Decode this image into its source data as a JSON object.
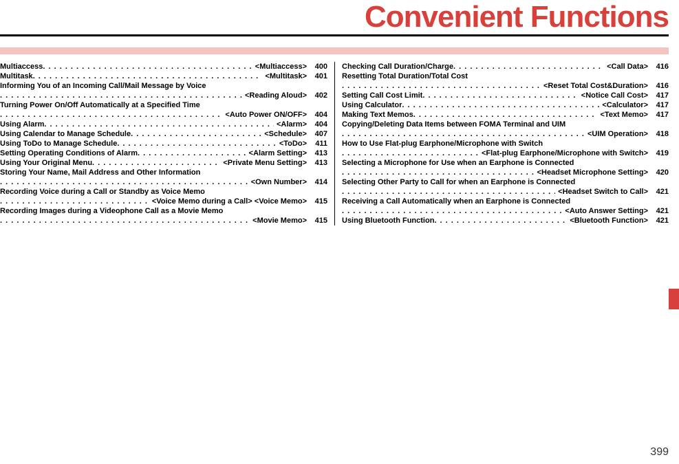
{
  "title": "Convenient Functions",
  "page_number": "399",
  "left": [
    {
      "label": "Multiaccess",
      "tag": "<Multiaccess>",
      "pg": "400"
    },
    {
      "label": "Multitask",
      "tag": "<Multitask>",
      "pg": "401"
    },
    {
      "wrap": "Informing You of an Incoming Call/Mail Message by Voice",
      "tag": "<Reading Aloud>",
      "pg": "402"
    },
    {
      "wrap": "Turning Power On/Off Automatically at a Specified Time",
      "tag": "<Auto Power ON/OFF>",
      "pg": "404"
    },
    {
      "label": "Using Alarm",
      "tag": "<Alarm>",
      "pg": "404"
    },
    {
      "label": "Using Calendar to Manage Schedule",
      "tag": "<Schedule>",
      "pg": "407"
    },
    {
      "label": "Using ToDo to Manage Schedule",
      "tag": "<ToDo>",
      "pg": "411"
    },
    {
      "label": "Setting Operating Conditions of Alarm",
      "tag": "<Alarm Setting>",
      "pg": "413"
    },
    {
      "label": "Using Your Original Menu",
      "tag": "<Private Menu Setting>",
      "pg": "413"
    },
    {
      "wrap": "Storing Your Name, Mail Address and Other Information",
      "tag": "<Own Number>",
      "pg": "414"
    },
    {
      "wrap": "Recording Voice during a Call or Standby as Voice Memo",
      "tag": "<Voice Memo during a Call> <Voice Memo>",
      "pg": "415"
    },
    {
      "wrap": "Recording Images during a Videophone Call as a Movie Memo",
      "tag": "<Movie Memo>",
      "pg": "415"
    }
  ],
  "right": [
    {
      "label": "Checking Call Duration/Charge",
      "tag": "<Call Data>",
      "pg": "416"
    },
    {
      "wrap": "Resetting Total Duration/Total Cost",
      "tag": "<Reset Total Cost&Duration>",
      "pg": "416"
    },
    {
      "label": "Setting Call Cost Limit",
      "tag": "<Notice Call Cost>",
      "pg": "417"
    },
    {
      "label": "Using Calculator",
      "tag": "<Calculator>",
      "pg": "417"
    },
    {
      "label": "Making Text Memos",
      "tag": "<Text Memo>",
      "pg": "417"
    },
    {
      "wrap": "Copying/Deleting Data Items between FOMA Terminal and UIM",
      "tag": "<UIM Operation>",
      "pg": "418"
    },
    {
      "wrap": "How to Use Flat-plug Earphone/Microphone with Switch",
      "tag": "<Flat-plug Earphone/Microphone with Switch>",
      "pg": "419"
    },
    {
      "wrap": "Selecting a Microphone for Use when an Earphone is Connected",
      "tag": "<Headset Microphone Setting>",
      "pg": "420"
    },
    {
      "wrap": "Selecting Other Party to Call for when an Earphone is Connected",
      "tag": "<Headset Switch to Call>",
      "pg": "421"
    },
    {
      "wrap": "Receiving a Call Automatically when an Earphone is Connected",
      "tag": "<Auto Answer Setting>",
      "pg": "421"
    },
    {
      "label": "Using Bluetooth Function",
      "tag": "<Bluetooth Function>",
      "pg": "421"
    }
  ]
}
